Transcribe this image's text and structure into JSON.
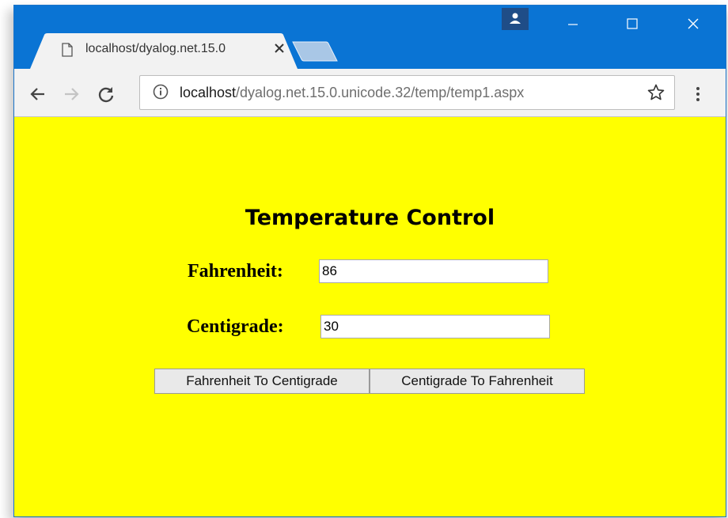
{
  "browser": {
    "tab": {
      "title": "localhost/dyalog.net.15.0",
      "favicon": "page-icon",
      "close_icon": "close-icon"
    },
    "address_bar": {
      "host": "localhost",
      "path": "/dyalog.net.15.0.unicode.32/temp/temp1.aspx"
    },
    "icons": {
      "back": "arrow-left-icon",
      "forward": "arrow-right-icon",
      "reload": "reload-icon",
      "info": "info-icon",
      "bookmark": "star-icon",
      "menu": "more-vertical-icon",
      "profile": "person-icon"
    },
    "colors": {
      "titlebar": "#0a74d4",
      "tab_bg": "#f2f2f2",
      "page_bg": "#ffff00"
    }
  },
  "page": {
    "heading": "Temperature Control",
    "fahrenheit": {
      "label": "Fahrenheit:",
      "value": "86"
    },
    "centigrade": {
      "label": "Centigrade:",
      "value": "30"
    },
    "buttons": {
      "f_to_c": "Fahrenheit To Centigrade",
      "c_to_f": "Centigrade To Fahrenheit"
    }
  }
}
